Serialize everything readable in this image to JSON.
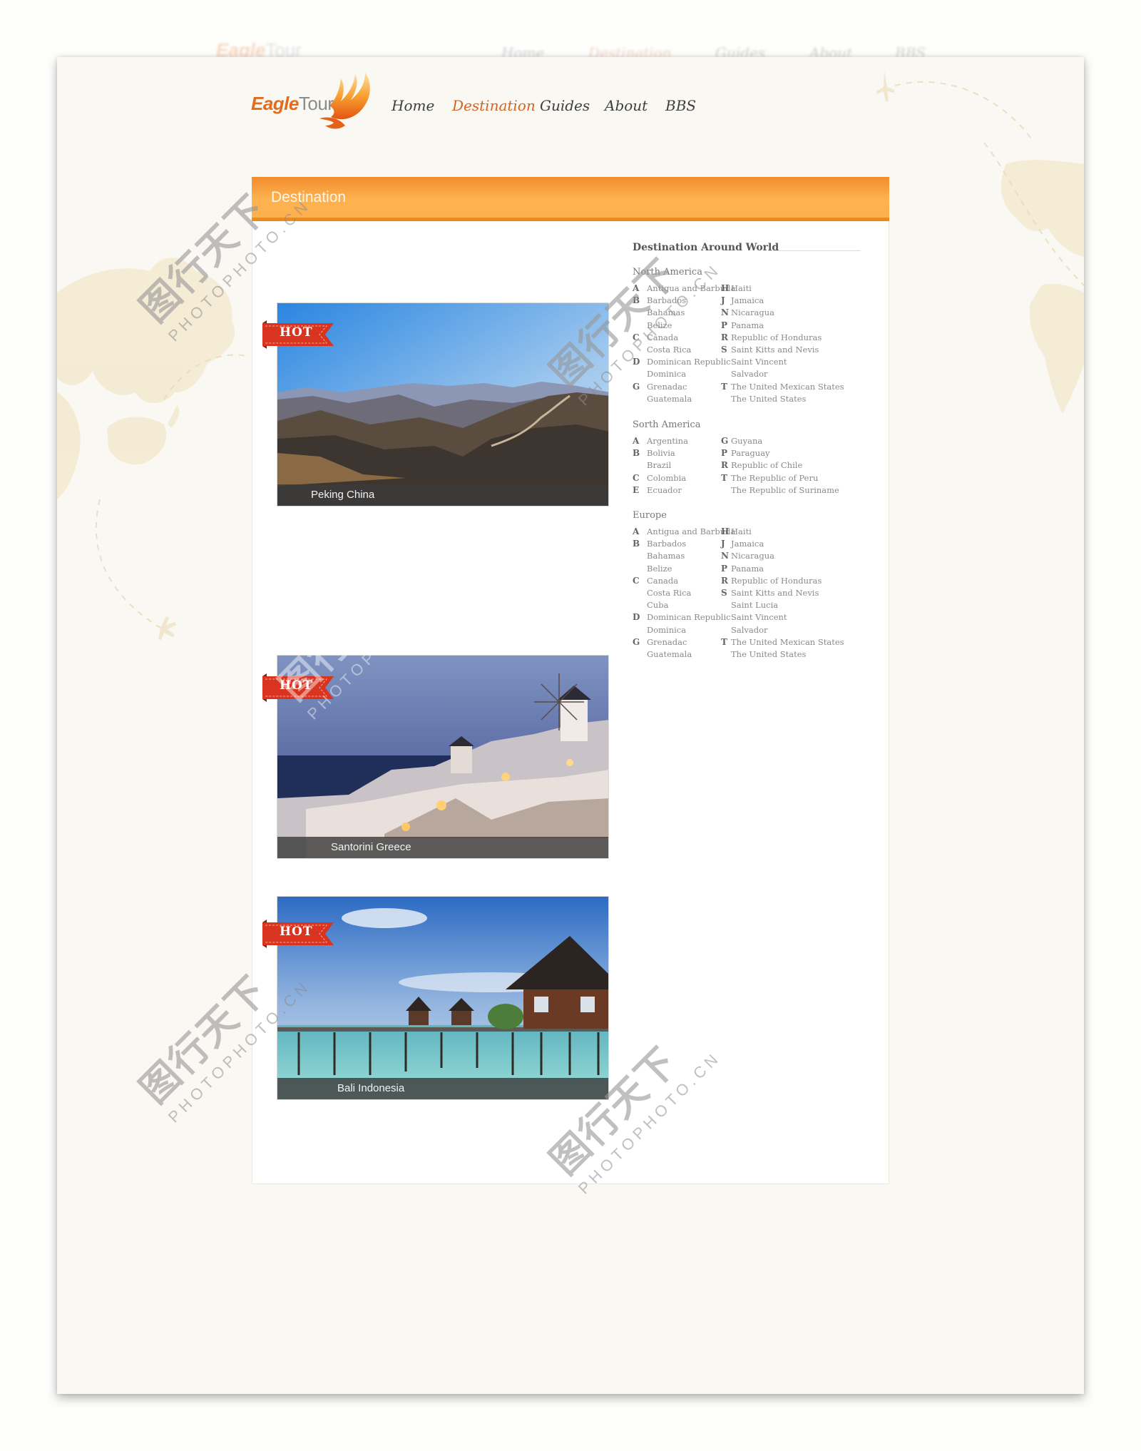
{
  "brand": {
    "name_part1": "Eagle",
    "name_part2": "Tour",
    "accent_color": "#e36b1e",
    "header_orange": "#f8a23e",
    "ribbon_red": "#d93420"
  },
  "nav": {
    "items": [
      {
        "label": "Home",
        "active": false
      },
      {
        "label": "Destination",
        "active": true
      },
      {
        "label": "Guides",
        "active": false
      },
      {
        "label": "About",
        "active": false
      },
      {
        "label": "BBS",
        "active": false
      }
    ]
  },
  "panel": {
    "title": "Destination"
  },
  "destinations": [
    {
      "caption": "Peking China",
      "badge": "HOT",
      "scene": "mountains-great-wall"
    },
    {
      "caption": "Santorini Greece",
      "badge": "HOT",
      "scene": "windmill-village-dusk"
    },
    {
      "caption": "Bali Indonesia",
      "badge": "HOT",
      "scene": "stilt-houses-sea"
    }
  ],
  "directory": {
    "title": "Destination Around World",
    "regions": [
      {
        "name": "North America",
        "left": [
          {
            "letter": "A",
            "name": "Antigua and Barbuda"
          },
          {
            "letter": "B",
            "name": "Barbados"
          },
          {
            "letter": "",
            "name": "Bahamas"
          },
          {
            "letter": "",
            "name": "Belize"
          },
          {
            "letter": "C",
            "name": "Canada"
          },
          {
            "letter": "",
            "name": "Costa Rica"
          },
          {
            "letter": "D",
            "name": "Dominican Republic"
          },
          {
            "letter": "",
            "name": "Dominica"
          },
          {
            "letter": "G",
            "name": "Grenadac"
          },
          {
            "letter": "",
            "name": "Guatemala"
          }
        ],
        "right": [
          {
            "letter": "H",
            "name": "Haiti"
          },
          {
            "letter": "J",
            "name": "Jamaica"
          },
          {
            "letter": "N",
            "name": "Nicaragua"
          },
          {
            "letter": "P",
            "name": "Panama"
          },
          {
            "letter": "R",
            "name": "Republic of Honduras"
          },
          {
            "letter": "S",
            "name": "Saint Kitts and Nevis"
          },
          {
            "letter": "",
            "name": "Saint Vincent"
          },
          {
            "letter": "",
            "name": "Salvador"
          },
          {
            "letter": "T",
            "name": "The United Mexican States"
          },
          {
            "letter": "",
            "name": "The United States"
          }
        ]
      },
      {
        "name": "Sorth America",
        "left": [
          {
            "letter": "A",
            "name": "Argentina"
          },
          {
            "letter": "B",
            "name": "Bolivia"
          },
          {
            "letter": "",
            "name": "Brazil"
          },
          {
            "letter": "C",
            "name": "Colombia"
          },
          {
            "letter": "E",
            "name": "Ecuador"
          }
        ],
        "right": [
          {
            "letter": "G",
            "name": "Guyana"
          },
          {
            "letter": "P",
            "name": "Paraguay"
          },
          {
            "letter": "R",
            "name": "Republic of Chile"
          },
          {
            "letter": "T",
            "name": "The Republic of Peru"
          },
          {
            "letter": "",
            "name": "The Republic of Suriname"
          }
        ]
      },
      {
        "name": "Europe",
        "left": [
          {
            "letter": "A",
            "name": "Antigua and Barbuda"
          },
          {
            "letter": "B",
            "name": "Barbados"
          },
          {
            "letter": "",
            "name": "Bahamas"
          },
          {
            "letter": "",
            "name": "Belize"
          },
          {
            "letter": "C",
            "name": "Canada"
          },
          {
            "letter": "",
            "name": "Costa Rica"
          },
          {
            "letter": "",
            "name": "Cuba"
          },
          {
            "letter": "D",
            "name": "Dominican Republic"
          },
          {
            "letter": "",
            "name": "Dominica"
          },
          {
            "letter": "G",
            "name": "Grenadac"
          },
          {
            "letter": "",
            "name": "Guatemala"
          }
        ],
        "right": [
          {
            "letter": "H",
            "name": "Haiti"
          },
          {
            "letter": "J",
            "name": "Jamaica"
          },
          {
            "letter": "N",
            "name": "Nicaragua"
          },
          {
            "letter": "P",
            "name": "Panama"
          },
          {
            "letter": "R",
            "name": "Republic of Honduras"
          },
          {
            "letter": "S",
            "name": "Saint Kitts and Nevis"
          },
          {
            "letter": "",
            "name": "Saint Lucia"
          },
          {
            "letter": "",
            "name": "Saint Vincent"
          },
          {
            "letter": "",
            "name": "Salvador"
          },
          {
            "letter": "T",
            "name": "The United Mexican States"
          },
          {
            "letter": "",
            "name": "The United States"
          }
        ]
      }
    ]
  },
  "watermark": {
    "text_cn": "图行天下",
    "text_en": "PHOTOPHOTO.CN"
  }
}
